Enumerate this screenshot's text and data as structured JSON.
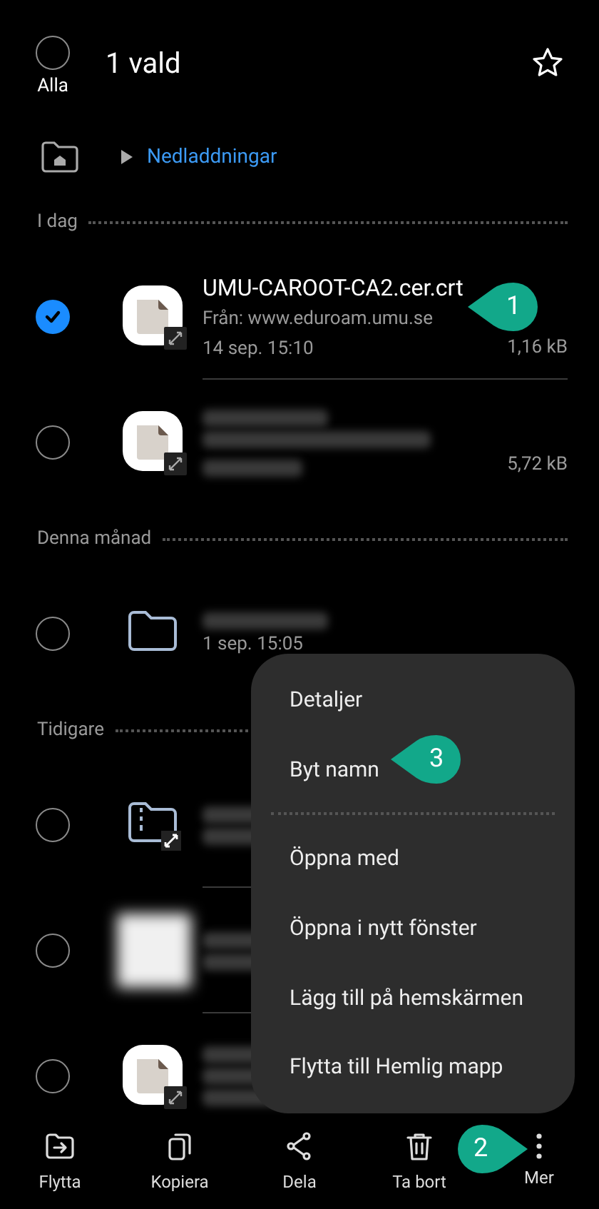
{
  "header": {
    "select_all": {
      "label": "Alla",
      "checked": false
    },
    "title": "1 vald"
  },
  "breadcrumb": {
    "folder": "Nedladdningar"
  },
  "sections": [
    {
      "label": "I dag",
      "rows": [
        {
          "kind": "file",
          "selected": true,
          "title": "UMU-CAROOT-CA2.cer.crt",
          "subtitle": "Från: www.eduroam.umu.se",
          "date": "14 sep. 15:10",
          "size": "1,16 kB"
        },
        {
          "kind": "file",
          "selected": false,
          "size": "5,72 kB"
        }
      ]
    },
    {
      "label": "Denna månad",
      "rows": [
        {
          "kind": "folder",
          "selected": false,
          "date": "1 sep. 15:05"
        }
      ]
    },
    {
      "label": "Tidigare",
      "rows": [
        {
          "kind": "archive",
          "selected": false
        },
        {
          "kind": "image",
          "selected": false
        },
        {
          "kind": "file",
          "selected": false
        }
      ]
    }
  ],
  "menu": {
    "items": [
      "Detaljer",
      "Byt namn",
      "Öppna med",
      "Öppna i nytt fönster",
      "Lägg till på hemskärmen",
      "Flytta till Hemlig mapp"
    ]
  },
  "bottom_bar": [
    {
      "kind": "move",
      "label": "Flytta"
    },
    {
      "kind": "copy",
      "label": "Kopiera"
    },
    {
      "kind": "share",
      "label": "Dela"
    },
    {
      "kind": "delete",
      "label": "Ta bort"
    },
    {
      "kind": "more",
      "label": "Mer"
    }
  ],
  "annotations": [
    {
      "kind": "left",
      "text": "1"
    },
    {
      "kind": "left",
      "text": "3"
    },
    {
      "kind": "right",
      "text": "2"
    }
  ]
}
